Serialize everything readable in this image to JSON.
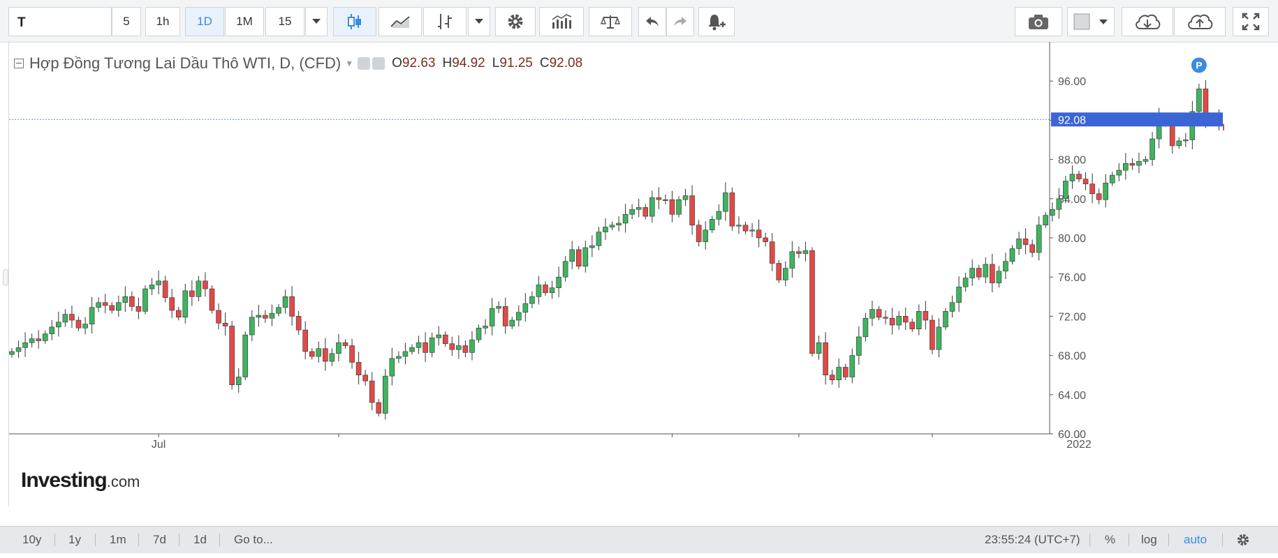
{
  "toolbar": {
    "symbol": "T",
    "intervals": [
      "5",
      "1h",
      "1D",
      "1M",
      "15"
    ],
    "active_interval": "1D",
    "icons": [
      "candles-icon",
      "line-chart-icon",
      "indicators-icon",
      "chevron-down-icon",
      "settings-icon",
      "studies-icon",
      "compare-scale-icon",
      "undo-icon",
      "redo-icon",
      "alert-bell-icon",
      "camera-icon",
      "color-square-icon",
      "cloud-download-icon",
      "cloud-upload-icon",
      "fullscreen-icon"
    ]
  },
  "legend": {
    "title": "Hợp Đồng Tương Lai Dầu Thô WTI, D, (CFD)",
    "o_label": "O",
    "o_value": "92.63",
    "h_label": "H",
    "h_value": "94.92",
    "l_label": "L",
    "l_value": "91.25",
    "c_label": "C",
    "c_value": "92.08"
  },
  "logo": {
    "main": "Investing",
    "suffix": ".com"
  },
  "bottombar": {
    "ranges": [
      "10y",
      "1y",
      "1m",
      "7d",
      "1d"
    ],
    "goto": "Go to...",
    "time": "23:55:24 (UTC+7)",
    "percent": "%",
    "log": "log",
    "auto": "auto"
  },
  "colors": {
    "up": "#3fb35f",
    "down": "#e04a48",
    "price_badge": "#3b64d4",
    "accent": "#3a8be0"
  },
  "chart_data": {
    "type": "candlestick",
    "title": "Hợp Đồng Tương Lai Dầu Thô WTI, D, (CFD)",
    "ylim": [
      60,
      100
    ],
    "y_ticks": [
      "60.00",
      "64.00",
      "68.00",
      "72.00",
      "76.00",
      "80.00",
      "84.00",
      "88.00",
      "92.00",
      "96.00"
    ],
    "x_labels": [
      {
        "label": "Jul",
        "index": 22
      },
      {
        "label": "2022",
        "index": 160
      }
    ],
    "last_price": "92.08",
    "marker": "P",
    "closes": [
      68.4,
      68.8,
      69.3,
      69.7,
      69.5,
      70.2,
      70.9,
      71.4,
      72.2,
      71.6,
      70.8,
      71.2,
      72.9,
      73.4,
      73.1,
      72.6,
      73.4,
      74.0,
      73.0,
      72.5,
      74.8,
      75.2,
      75.6,
      73.9,
      72.6,
      71.9,
      74.6,
      74.0,
      75.6,
      74.8,
      72.6,
      71.3,
      71.0,
      65.0,
      65.8,
      70.1,
      71.9,
      72.1,
      71.8,
      72.3,
      72.9,
      74.0,
      72.0,
      70.6,
      68.4,
      67.9,
      68.7,
      67.4,
      68.2,
      69.3,
      69.0,
      67.3,
      66.0,
      65.4,
      63.2,
      62.1,
      65.9,
      67.7,
      67.9,
      68.4,
      68.8,
      69.3,
      68.3,
      69.8,
      70.1,
      69.2,
      68.6,
      69.0,
      68.3,
      69.6,
      70.8,
      71.0,
      72.8,
      73.0,
      71.0,
      71.6,
      72.4,
      73.3,
      74.0,
      75.2,
      74.4,
      74.9,
      76.0,
      77.6,
      78.8,
      77.1,
      79.0,
      79.2,
      80.6,
      81.1,
      81.3,
      81.5,
      82.4,
      82.9,
      83.1,
      82.2,
      84.1,
      83.9,
      83.9,
      82.4,
      83.9,
      84.3,
      81.3,
      79.6,
      80.8,
      81.9,
      82.7,
      84.6,
      81.2,
      81.3,
      80.7,
      80.8,
      80.0,
      79.6,
      77.4,
      75.7,
      76.9,
      78.6,
      78.4,
      78.7,
      68.2,
      69.3,
      66.0,
      65.5,
      66.8,
      65.8,
      68.0,
      69.9,
      71.8,
      72.7,
      71.9,
      71.8,
      71.1,
      72.0,
      71.4,
      70.7,
      72.5,
      71.6,
      68.6,
      70.9,
      72.5,
      73.4,
      75.0,
      75.9,
      76.9,
      76.0,
      77.3,
      75.4,
      76.6,
      77.6,
      78.9,
      79.9,
      79.3,
      78.5,
      81.3,
      82.3,
      82.9,
      84.0,
      85.8,
      86.5,
      86.0,
      85.5,
      84.5,
      83.9,
      85.6,
      86.4,
      86.9,
      87.6,
      87.4,
      87.8,
      88.0,
      90.1,
      92.2,
      91.8,
      89.4,
      89.9,
      90.0,
      92.9,
      95.2,
      92.0,
      92.4,
      91.6,
      91.0,
      92.0,
      92.08
    ],
    "opens": [
      68.1,
      68.4,
      68.8,
      69.3,
      69.7,
      69.5,
      70.2,
      70.9,
      71.4,
      72.2,
      71.6,
      70.8,
      71.2,
      72.9,
      73.4,
      73.1,
      72.6,
      73.4,
      74.0,
      73.0,
      72.5,
      74.8,
      75.2,
      75.6,
      73.9,
      72.6,
      71.9,
      74.6,
      74.0,
      75.6,
      74.8,
      72.6,
      71.3,
      71.0,
      65.0,
      65.8,
      70.1,
      71.9,
      72.1,
      71.8,
      72.3,
      72.9,
      74.0,
      72.0,
      70.6,
      68.4,
      67.9,
      68.7,
      67.4,
      68.2,
      69.3,
      69.0,
      67.3,
      66.0,
      65.4,
      63.2,
      62.1,
      65.9,
      67.7,
      67.9,
      68.4,
      68.8,
      69.3,
      68.3,
      69.8,
      70.1,
      69.2,
      68.6,
      69.0,
      68.3,
      69.6,
      70.8,
      71.0,
      72.8,
      73.0,
      71.0,
      71.6,
      72.4,
      73.3,
      74.0,
      75.2,
      74.4,
      74.9,
      76.0,
      77.6,
      78.8,
      77.1,
      79.0,
      79.2,
      80.6,
      81.1,
      81.3,
      81.5,
      82.4,
      82.9,
      83.1,
      82.2,
      84.1,
      83.9,
      83.9,
      82.4,
      83.9,
      84.3,
      81.3,
      79.6,
      80.8,
      81.9,
      82.7,
      84.6,
      81.2,
      81.3,
      80.7,
      80.8,
      80.0,
      79.6,
      77.4,
      75.7,
      76.9,
      78.6,
      78.4,
      78.7,
      68.2,
      69.3,
      66.0,
      65.5,
      66.8,
      65.8,
      68.0,
      69.9,
      71.8,
      72.7,
      71.9,
      71.8,
      71.1,
      72.0,
      71.4,
      70.7,
      72.5,
      71.6,
      68.6,
      70.9,
      72.5,
      73.4,
      75.0,
      75.9,
      76.9,
      76.0,
      77.3,
      75.4,
      76.6,
      77.6,
      78.9,
      79.9,
      79.3,
      78.5,
      81.3,
      82.3,
      82.9,
      84.0,
      85.8,
      86.5,
      86.0,
      85.5,
      84.5,
      83.9,
      85.6,
      86.4,
      86.9,
      87.6,
      87.4,
      87.8,
      88.0,
      90.1,
      92.2,
      91.8,
      89.4,
      89.9,
      90.0,
      92.9,
      95.2,
      92.0,
      92.4,
      91.6,
      91.0,
      92.63
    ]
  }
}
